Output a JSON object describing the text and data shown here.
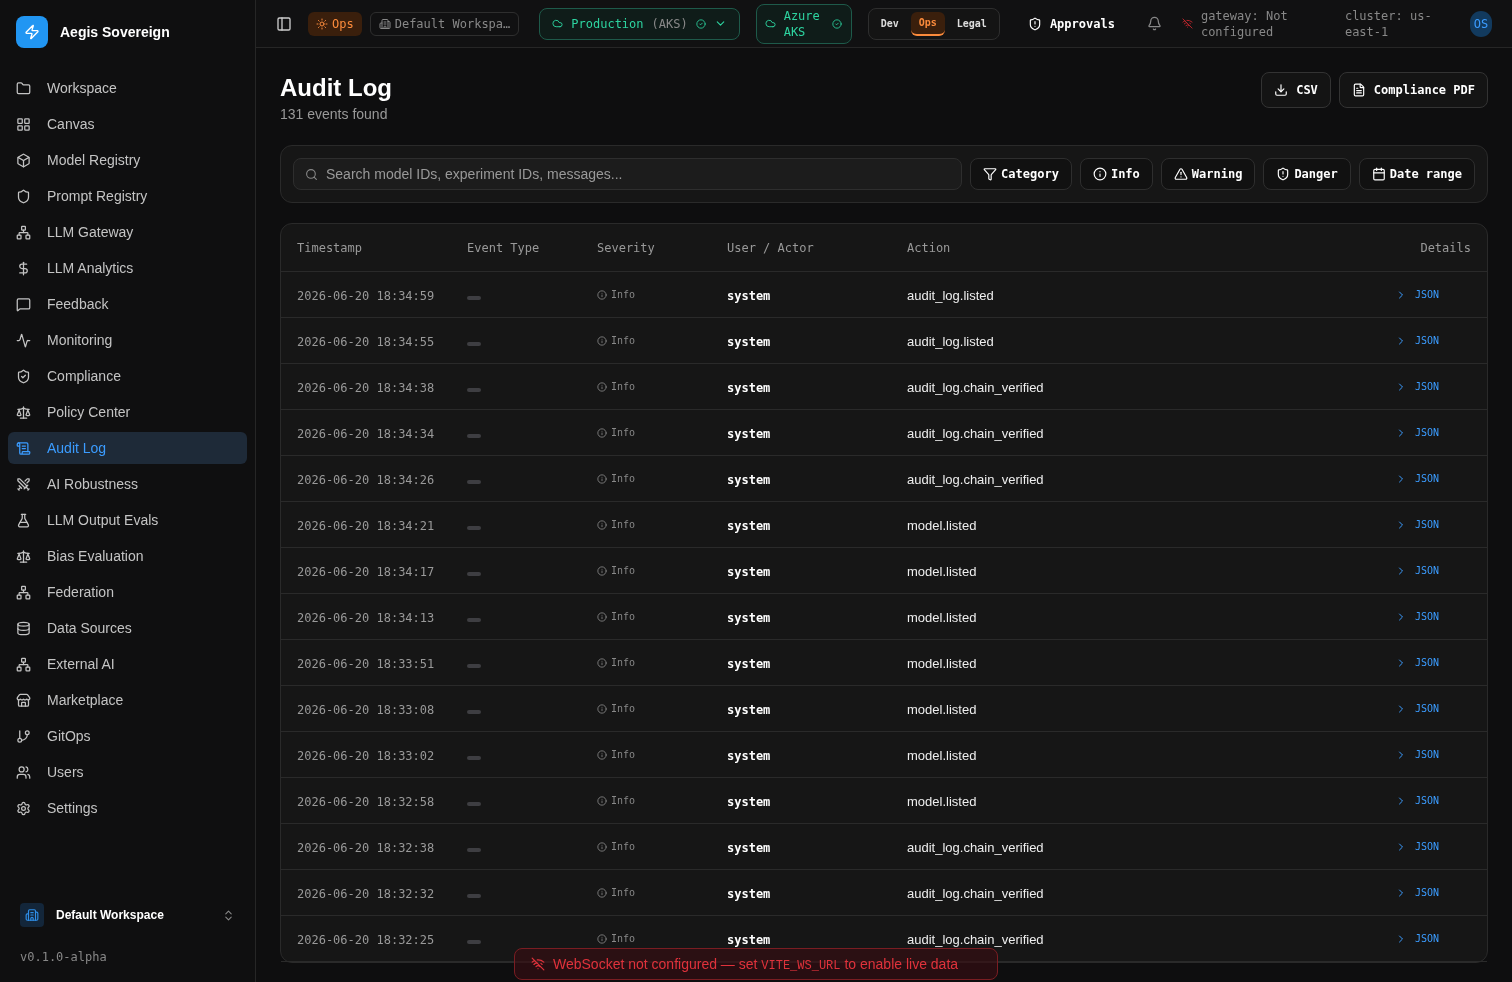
{
  "brand": {
    "name": "Aegis Sovereign"
  },
  "sidebar": {
    "items": [
      {
        "label": "Workspace",
        "selected": false
      },
      {
        "label": "Canvas",
        "selected": false
      },
      {
        "label": "Model Registry",
        "selected": false
      },
      {
        "label": "Prompt Registry",
        "selected": false
      },
      {
        "label": "LLM Gateway",
        "selected": false
      },
      {
        "label": "LLM Analytics",
        "selected": false
      },
      {
        "label": "Feedback",
        "selected": false
      },
      {
        "label": "Monitoring",
        "selected": false
      },
      {
        "label": "Compliance",
        "selected": false
      },
      {
        "label": "Policy Center",
        "selected": false
      },
      {
        "label": "Audit Log",
        "selected": true
      },
      {
        "label": "AI Robustness",
        "selected": false
      },
      {
        "label": "LLM Output Evals",
        "selected": false
      },
      {
        "label": "Bias Evaluation",
        "selected": false
      },
      {
        "label": "Federation",
        "selected": false
      },
      {
        "label": "Data Sources",
        "selected": false
      },
      {
        "label": "External AI",
        "selected": false
      },
      {
        "label": "Marketplace",
        "selected": false
      },
      {
        "label": "GitOps",
        "selected": false
      },
      {
        "label": "Users",
        "selected": false
      },
      {
        "label": "Settings",
        "selected": false
      }
    ],
    "workspace": "Default Workspace",
    "version": "v0.1.0-alpha"
  },
  "topbar": {
    "mode_badge": "Ops",
    "workspace": "Default Workspa…",
    "environment": {
      "name": "Production",
      "platform": "(AKS)"
    },
    "cloud": "Azure AKS",
    "roles": [
      {
        "label": "Dev",
        "selected": false
      },
      {
        "label": "Ops",
        "selected": true
      },
      {
        "label": "Legal",
        "selected": false
      }
    ],
    "approvals": "Approvals",
    "gateway": "gateway: Not configured",
    "cluster": "cluster: us-east-1",
    "avatar": "OS"
  },
  "page": {
    "title": "Audit Log",
    "subtitle": "131 events found",
    "actions": [
      "CSV",
      "Compliance PDF"
    ]
  },
  "filters": {
    "search": {
      "placeholder": "Search model IDs, experiment IDs, messages..."
    },
    "buttons": [
      {
        "label": "Category"
      },
      {
        "label": "Info"
      },
      {
        "label": "Warning"
      },
      {
        "label": "Danger"
      },
      {
        "label": "Date range"
      }
    ]
  },
  "table": {
    "columns": [
      "Timestamp",
      "Event Type",
      "Severity",
      "User / Actor",
      "Action",
      "Details"
    ],
    "rows": [
      {
        "timestamp": "2026-06-20 18:34:59",
        "severity": "Info",
        "actor": "system",
        "action": "audit_log.listed",
        "details": "JSON"
      },
      {
        "timestamp": "2026-06-20 18:34:55",
        "severity": "Info",
        "actor": "system",
        "action": "audit_log.listed",
        "details": "JSON"
      },
      {
        "timestamp": "2026-06-20 18:34:38",
        "severity": "Info",
        "actor": "system",
        "action": "audit_log.chain_verified",
        "details": "JSON"
      },
      {
        "timestamp": "2026-06-20 18:34:34",
        "severity": "Info",
        "actor": "system",
        "action": "audit_log.chain_verified",
        "details": "JSON"
      },
      {
        "timestamp": "2026-06-20 18:34:26",
        "severity": "Info",
        "actor": "system",
        "action": "audit_log.chain_verified",
        "details": "JSON"
      },
      {
        "timestamp": "2026-06-20 18:34:21",
        "severity": "Info",
        "actor": "system",
        "action": "model.listed",
        "details": "JSON"
      },
      {
        "timestamp": "2026-06-20 18:34:17",
        "severity": "Info",
        "actor": "system",
        "action": "model.listed",
        "details": "JSON"
      },
      {
        "timestamp": "2026-06-20 18:34:13",
        "severity": "Info",
        "actor": "system",
        "action": "model.listed",
        "details": "JSON"
      },
      {
        "timestamp": "2026-06-20 18:33:51",
        "severity": "Info",
        "actor": "system",
        "action": "model.listed",
        "details": "JSON"
      },
      {
        "timestamp": "2026-06-20 18:33:08",
        "severity": "Info",
        "actor": "system",
        "action": "model.listed",
        "details": "JSON"
      },
      {
        "timestamp": "2026-06-20 18:33:02",
        "severity": "Info",
        "actor": "system",
        "action": "model.listed",
        "details": "JSON"
      },
      {
        "timestamp": "2026-06-20 18:32:58",
        "severity": "Info",
        "actor": "system",
        "action": "model.listed",
        "details": "JSON"
      },
      {
        "timestamp": "2026-06-20 18:32:38",
        "severity": "Info",
        "actor": "system",
        "action": "audit_log.chain_verified",
        "details": "JSON"
      },
      {
        "timestamp": "2026-06-20 18:32:32",
        "severity": "Info",
        "actor": "system",
        "action": "audit_log.chain_verified",
        "details": "JSON"
      },
      {
        "timestamp": "2026-06-20 18:32:25",
        "severity": "Info",
        "actor": "system",
        "action": "audit_log.chain_verified",
        "details": "JSON"
      }
    ]
  },
  "toast": {
    "message": "WebSocket not configured — set",
    "code": "VITE_WS_URL",
    "suffix": "to enable live data"
  }
}
